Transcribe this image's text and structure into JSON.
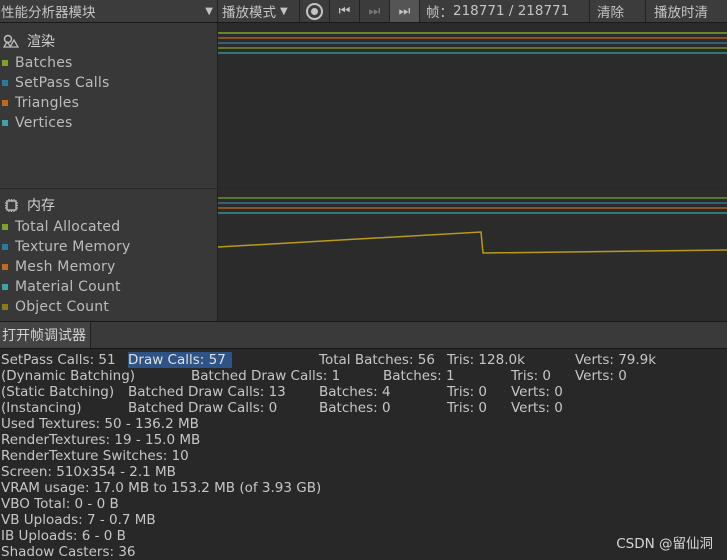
{
  "toolbar": {
    "module_dropdown": "性能分析器模块",
    "play_mode": "播放模式",
    "frame_label": "帧：",
    "frame_current": "218771",
    "frame_sep": " / ",
    "frame_total": "218771",
    "clear": "清除",
    "clear_on_play": "播放时清"
  },
  "rendering": {
    "title": "渲染",
    "items": [
      {
        "label": "Batches",
        "color": "#7fa12b"
      },
      {
        "label": "SetPass Calls",
        "color": "#2a7ba0"
      },
      {
        "label": "Triangles",
        "color": "#c16a1c"
      },
      {
        "label": "Vertices",
        "color": "#3fa2a6"
      }
    ]
  },
  "memory": {
    "title": "内存",
    "items": [
      {
        "label": "Total Allocated",
        "color": "#7fa12b"
      },
      {
        "label": "Texture Memory",
        "color": "#2a7ba0"
      },
      {
        "label": "Mesh Memory",
        "color": "#c16a1c"
      },
      {
        "label": "Material Count",
        "color": "#3fa2a6"
      },
      {
        "label": "Object Count",
        "color": "#8a7a18"
      }
    ]
  },
  "frame_debugger": {
    "label": "打开帧调试器"
  },
  "stats": {
    "setpass": "SetPass Calls: 51",
    "draw_calls": "Draw Calls: 57",
    "total_batches": "Total Batches: 56",
    "tris": "Tris: 128.0k",
    "verts": "Verts: 79.9k",
    "dynamic": "(Dynamic Batching)",
    "dyn_batched": "Batched Draw Calls: 1",
    "dyn_batches": "Batches: 1",
    "dyn_tris": "Tris: 0",
    "dyn_verts": "Verts: 0",
    "static": "(Static Batching)",
    "st_batched": "Batched Draw Calls: 13",
    "st_batches": "Batches: 4",
    "st_tris": "Tris: 0",
    "st_verts": "Verts: 0",
    "instancing": "(Instancing)",
    "in_batched": "Batched Draw Calls: 0",
    "in_batches": "Batches: 0",
    "in_tris": "Tris: 0",
    "in_verts": "Verts: 0",
    "used_textures": "Used Textures: 50 - 136.2 MB",
    "render_textures": "RenderTextures: 19 - 15.0 MB",
    "rt_switches": "RenderTexture Switches: 10",
    "screen": "Screen: 510x354 - 2.1 MB",
    "vram": "VRAM usage: 17.0 MB to 153.2 MB (of 3.93 GB)",
    "vbo": "VBO Total: 0 - 0 B",
    "vb_uploads": "VB Uploads: 7 - 0.7 MB",
    "ib_uploads": "IB Uploads: 6 - 0 B",
    "shadow": "Shadow Casters: 36"
  },
  "watermark": "CSDN @留仙洞"
}
